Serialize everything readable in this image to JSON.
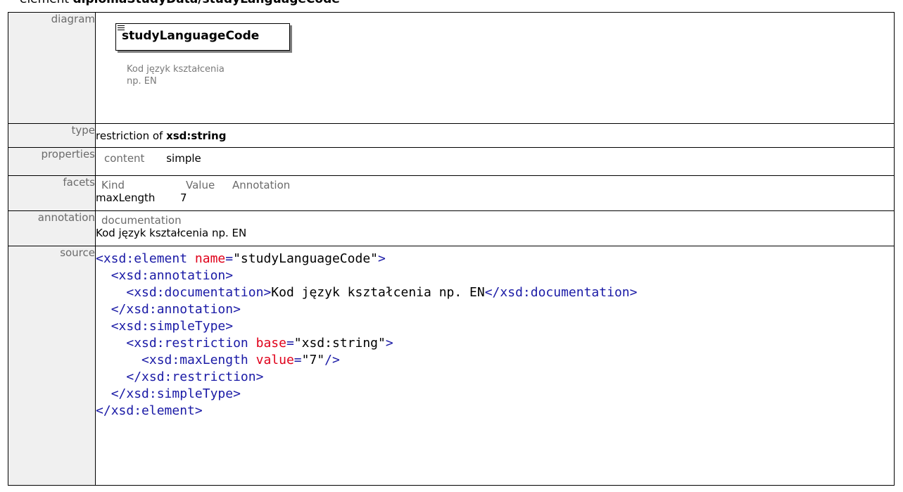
{
  "heading": {
    "prefix": "element ",
    "path": "diplomaStudyData/studyLanguageCode"
  },
  "rows": {
    "diagram": {
      "label": "diagram",
      "element_name": "studyLanguageCode",
      "note": "Kod język kształcenia np. EN"
    },
    "type": {
      "label": "type",
      "prefix": "restriction of ",
      "base": "xsd:string"
    },
    "properties": {
      "label": "properties",
      "key": "content",
      "value": "simple"
    },
    "facets": {
      "label": "facets",
      "headers": [
        "Kind",
        "Value",
        "Annotation"
      ],
      "kind": "maxLength",
      "value": "7"
    },
    "annotation": {
      "label": "annotation",
      "header": "documentation",
      "text": "Kod język kształcenia np. EN"
    },
    "source": {
      "label": "source",
      "lines": [
        {
          "indent": "",
          "open": "<",
          "tag": "xsd:element",
          "attr": " name",
          "eq": "=",
          "val": "\"studyLanguageCode\"",
          "close": ">",
          "text": "",
          "etag": ""
        },
        {
          "indent": "  ",
          "open": "<",
          "tag": "xsd:annotation",
          "attr": "",
          "eq": "",
          "val": "",
          "close": ">",
          "text": "",
          "etag": ""
        },
        {
          "indent": "    ",
          "open": "<",
          "tag": "xsd:documentation",
          "attr": "",
          "eq": "",
          "val": "",
          "close": ">",
          "text": "Kod język kształcenia np. EN",
          "etag": "</xsd:documentation>"
        },
        {
          "indent": "  ",
          "open": "</",
          "tag": "xsd:annotation",
          "attr": "",
          "eq": "",
          "val": "",
          "close": ">",
          "text": "",
          "etag": ""
        },
        {
          "indent": "  ",
          "open": "<",
          "tag": "xsd:simpleType",
          "attr": "",
          "eq": "",
          "val": "",
          "close": ">",
          "text": "",
          "etag": ""
        },
        {
          "indent": "    ",
          "open": "<",
          "tag": "xsd:restriction",
          "attr": " base",
          "eq": "=",
          "val": "\"xsd:string\"",
          "close": ">",
          "text": "",
          "etag": ""
        },
        {
          "indent": "      ",
          "open": "<",
          "tag": "xsd:maxLength",
          "attr": " value",
          "eq": "=",
          "val": "\"7\"",
          "close": "/>",
          "text": "",
          "etag": ""
        },
        {
          "indent": "    ",
          "open": "</",
          "tag": "xsd:restriction",
          "attr": "",
          "eq": "",
          "val": "",
          "close": ">",
          "text": "",
          "etag": ""
        },
        {
          "indent": "  ",
          "open": "</",
          "tag": "xsd:simpleType",
          "attr": "",
          "eq": "",
          "val": "",
          "close": ">",
          "text": "",
          "etag": ""
        },
        {
          "indent": "",
          "open": "</",
          "tag": "xsd:element",
          "attr": "",
          "eq": "",
          "val": "",
          "close": ">",
          "text": "",
          "etag": ""
        }
      ]
    }
  },
  "colors": {
    "tag": "#1a1aa6",
    "attr": "#e0001a",
    "label_bg": "#f0f0f0",
    "muted": "#6b6b6b"
  }
}
